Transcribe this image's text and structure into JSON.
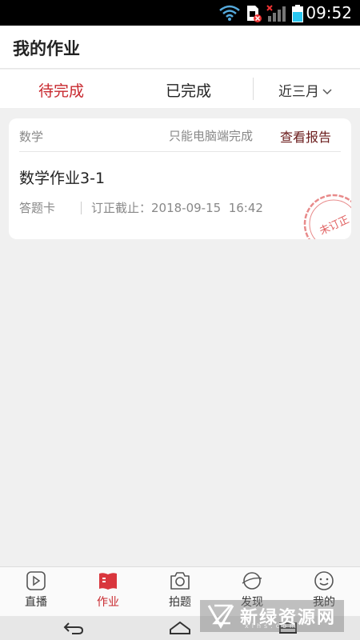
{
  "status_bar": {
    "time": "09:52"
  },
  "header": {
    "title": "我的作业"
  },
  "tabs": {
    "todo": "待完成",
    "done": "已完成",
    "filter": "近三月"
  },
  "card": {
    "subject": "数学",
    "pc_only": "只能电脑端完成",
    "report": "查看报告",
    "title": "数学作业3-1",
    "answer_card": "答题卡",
    "deadline": "订正截止：2018-09-15  16:42",
    "stamp": "未订正"
  },
  "bottom_nav": [
    {
      "label": "直播"
    },
    {
      "label": "作业"
    },
    {
      "label": "拍题"
    },
    {
      "label": "发现"
    },
    {
      "label": "我的"
    }
  ],
  "colors": {
    "accent": "#c8282e",
    "report": "#6a1b1b",
    "stamp": "#e06060"
  },
  "watermark": {
    "text": "新绿资源网",
    "sub": "xlhs.com"
  }
}
